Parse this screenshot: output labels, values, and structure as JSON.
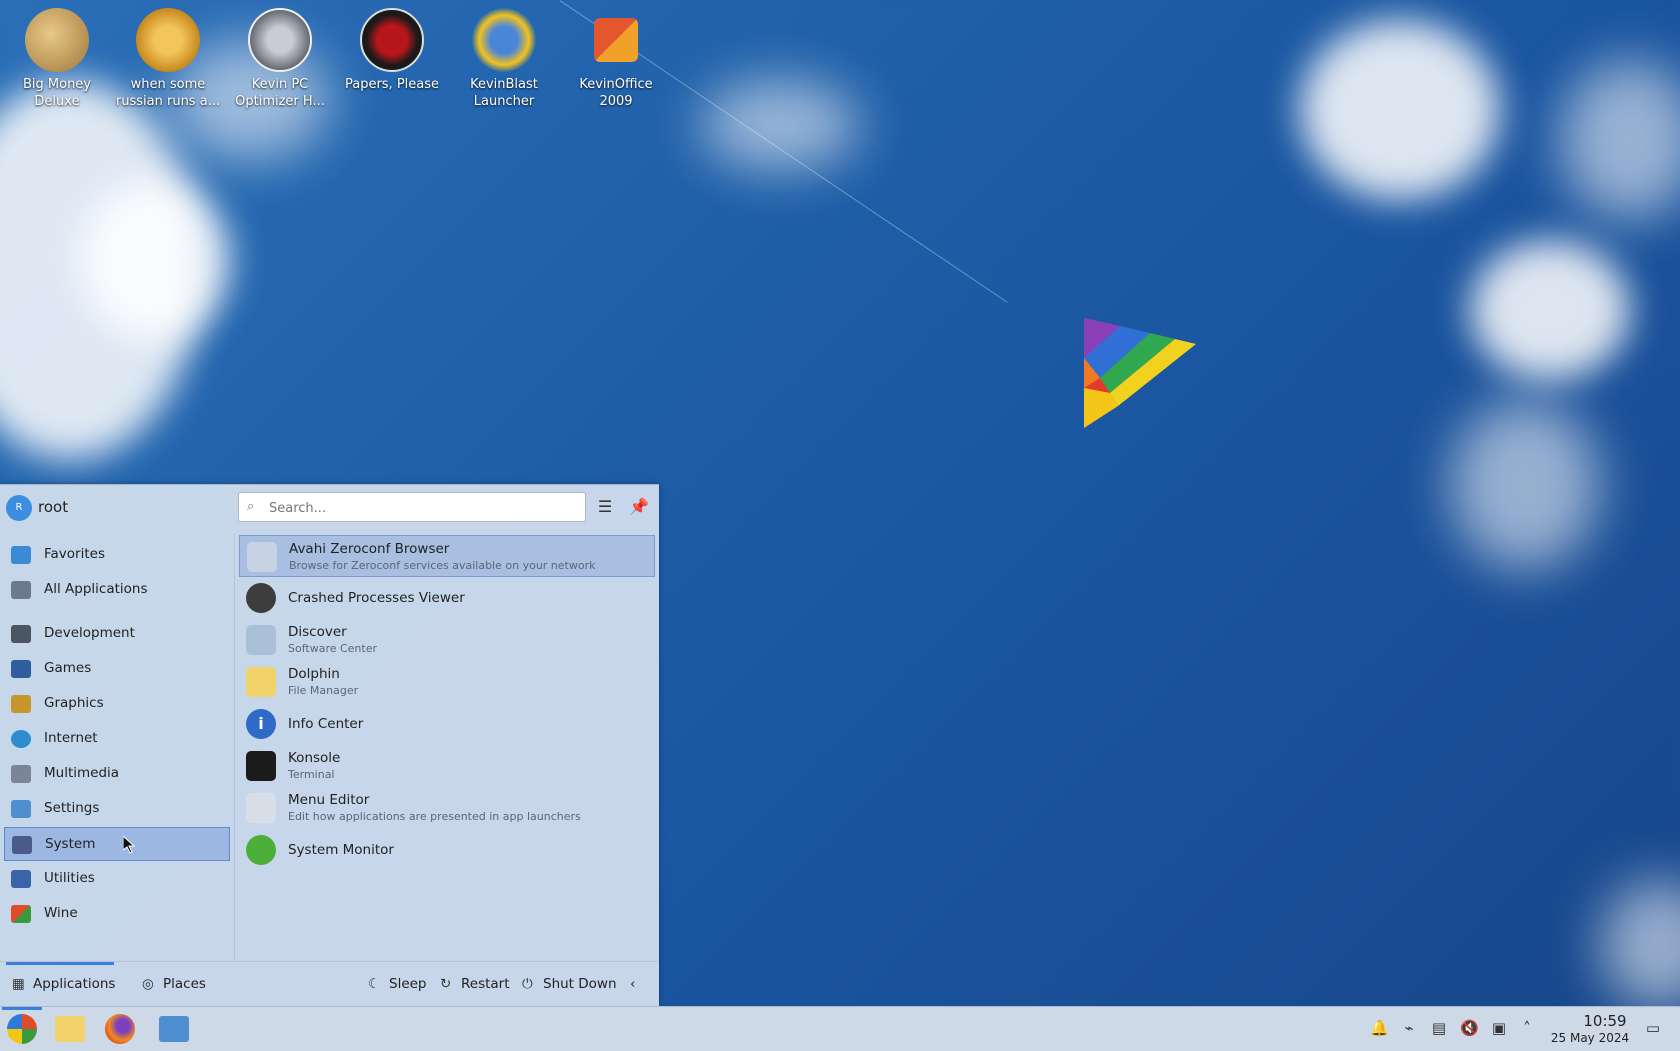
{
  "desktop": {
    "icons": [
      {
        "label_1": "Big Money",
        "label_2": "Deluxe",
        "icon": "money-bag-icon",
        "color": "#c8a25a"
      },
      {
        "label_1": "when some",
        "label_2": "russian runs a...",
        "icon": "gear-icon",
        "color": "#d7a031"
      },
      {
        "label_1": "Kevin PC",
        "label_2": "Optimizer H...",
        "icon": "gauge-icon",
        "color": "#7b7f86"
      },
      {
        "label_1": "Papers, Please",
        "label_2": "",
        "icon": "papers-please-icon",
        "color": "#8a0f12"
      },
      {
        "label_1": "KevinBlast",
        "label_2": "Launcher",
        "icon": "starburst-icon",
        "color": "#f2b01d"
      },
      {
        "label_1": "KevinOffice",
        "label_2": "2009",
        "icon": "office-logo-icon",
        "color": "#e4572e"
      }
    ]
  },
  "menu": {
    "user": {
      "avatar_letter": "R",
      "name": "root"
    },
    "search": {
      "placeholder": "Search..."
    },
    "sidebar": {
      "items": [
        {
          "label": "Favorites",
          "icon": "favorites-icon"
        },
        {
          "label": "All Applications",
          "icon": "grid-icon"
        },
        {
          "label": "Development",
          "icon": "development-icon"
        },
        {
          "label": "Games",
          "icon": "games-icon"
        },
        {
          "label": "Graphics",
          "icon": "graphics-icon"
        },
        {
          "label": "Internet",
          "icon": "globe-icon"
        },
        {
          "label": "Multimedia",
          "icon": "multimedia-icon"
        },
        {
          "label": "Settings",
          "icon": "settings-icon"
        },
        {
          "label": "System",
          "icon": "system-icon"
        },
        {
          "label": "Utilities",
          "icon": "utilities-icon"
        },
        {
          "label": "Wine",
          "icon": "wine-icon"
        }
      ],
      "selected": "System"
    },
    "apps": [
      {
        "name": "Avahi Zeroconf Browser",
        "desc": "Browse for Zeroconf services available on your network",
        "icon": "network-browser-icon"
      },
      {
        "name": "Crashed Processes Viewer",
        "desc": "",
        "icon": "bug-icon"
      },
      {
        "name": "Discover",
        "desc": "Software Center",
        "icon": "discover-icon"
      },
      {
        "name": "Dolphin",
        "desc": "File Manager",
        "icon": "folder-icon"
      },
      {
        "name": "Info Center",
        "desc": "",
        "icon": "info-icon"
      },
      {
        "name": "Konsole",
        "desc": "Terminal",
        "icon": "terminal-icon"
      },
      {
        "name": "Menu Editor",
        "desc": "Edit how applications are presented in app launchers",
        "icon": "menu-editor-icon"
      },
      {
        "name": "System Monitor",
        "desc": "",
        "icon": "system-monitor-icon"
      }
    ],
    "footer": {
      "applications": "Applications",
      "places": "Places",
      "sleep": "Sleep",
      "restart": "Restart",
      "shutdown": "Shut Down"
    }
  },
  "taskbar": {
    "clock_time": "10:59",
    "clock_date": "25 May 2024"
  },
  "colors": {
    "accent": "#3b7de0",
    "selection": "#9cb8e2"
  }
}
